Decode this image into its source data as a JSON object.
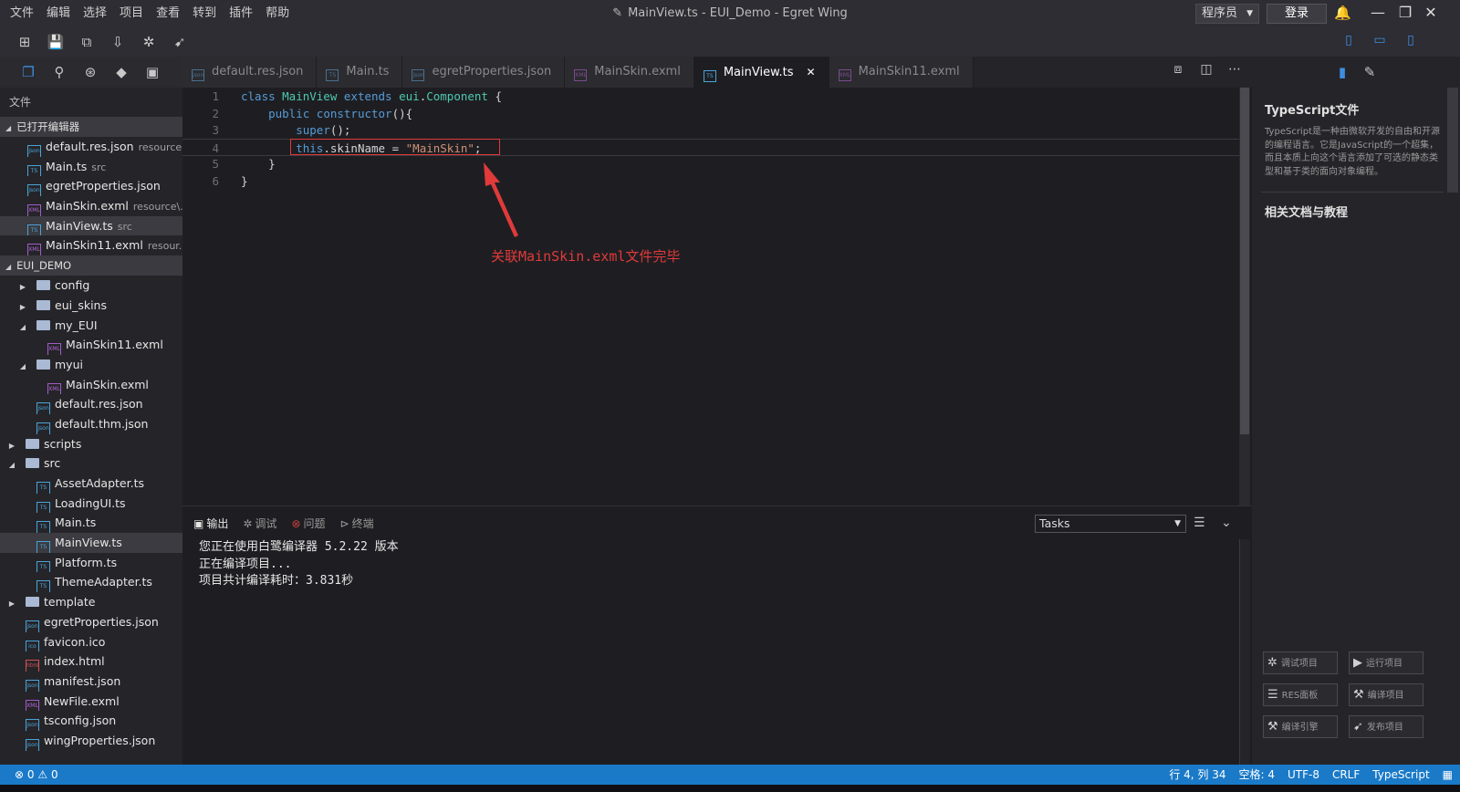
{
  "menu": [
    "文件",
    "编辑",
    "选择",
    "项目",
    "查看",
    "转到",
    "插件",
    "帮助"
  ],
  "window_title": "MainView.ts - EUI_Demo - Egret Wing",
  "role_select": "程序员",
  "login_label": "登录",
  "sidebar": {
    "files_title": "文件",
    "open_editors_header": "已打开编辑器",
    "open_editors": [
      {
        "name": "default.res.json",
        "hint": "resource",
        "icon": "json"
      },
      {
        "name": "Main.ts",
        "hint": "src",
        "icon": "ts"
      },
      {
        "name": "egretProperties.json",
        "hint": "",
        "icon": "json"
      },
      {
        "name": "MainSkin.exml",
        "hint": "resource\\...",
        "icon": "exml"
      },
      {
        "name": "MainView.ts",
        "hint": "src",
        "icon": "ts",
        "selected": true
      },
      {
        "name": "MainSkin11.exml",
        "hint": "resour...",
        "icon": "exml"
      }
    ],
    "project_header": "EUI_DEMO",
    "tree": [
      {
        "name": "config",
        "type": "folder",
        "depth": 2,
        "arrow": "▶"
      },
      {
        "name": "eui_skins",
        "type": "folder",
        "depth": 2,
        "arrow": "▶"
      },
      {
        "name": "my_EUI",
        "type": "folder",
        "depth": 2,
        "arrow": "◢"
      },
      {
        "name": "MainSkin11.exml",
        "type": "exml",
        "depth": 3,
        "arrow": ""
      },
      {
        "name": "myui",
        "type": "folder",
        "depth": 2,
        "arrow": "◢"
      },
      {
        "name": "MainSkin.exml",
        "type": "exml",
        "depth": 3,
        "arrow": ""
      },
      {
        "name": "default.res.json",
        "type": "json",
        "depth": 2,
        "arrow": ""
      },
      {
        "name": "default.thm.json",
        "type": "json",
        "depth": 2,
        "arrow": ""
      },
      {
        "name": "scripts",
        "type": "folder",
        "depth": 1,
        "arrow": "▶"
      },
      {
        "name": "src",
        "type": "folder",
        "depth": 1,
        "arrow": "◢"
      },
      {
        "name": "AssetAdapter.ts",
        "type": "ts",
        "depth": 2,
        "arrow": ""
      },
      {
        "name": "LoadingUI.ts",
        "type": "ts",
        "depth": 2,
        "arrow": ""
      },
      {
        "name": "Main.ts",
        "type": "ts",
        "depth": 2,
        "arrow": ""
      },
      {
        "name": "MainView.ts",
        "type": "ts",
        "depth": 2,
        "arrow": "",
        "selected": true
      },
      {
        "name": "Platform.ts",
        "type": "ts",
        "depth": 2,
        "arrow": ""
      },
      {
        "name": "ThemeAdapter.ts",
        "type": "ts",
        "depth": 2,
        "arrow": ""
      },
      {
        "name": "template",
        "type": "folder",
        "depth": 1,
        "arrow": "▶"
      },
      {
        "name": "egretProperties.json",
        "type": "json",
        "depth": 1,
        "arrow": ""
      },
      {
        "name": "favicon.ico",
        "type": "ico",
        "depth": 1,
        "arrow": ""
      },
      {
        "name": "index.html",
        "type": "html",
        "depth": 1,
        "arrow": ""
      },
      {
        "name": "manifest.json",
        "type": "json",
        "depth": 1,
        "arrow": ""
      },
      {
        "name": "NewFile.exml",
        "type": "exml",
        "depth": 1,
        "arrow": ""
      },
      {
        "name": "tsconfig.json",
        "type": "json",
        "depth": 1,
        "arrow": ""
      },
      {
        "name": "wingProperties.json",
        "type": "json",
        "depth": 1,
        "arrow": ""
      }
    ]
  },
  "tabs": [
    {
      "label": "default.res.json",
      "icon": "json"
    },
    {
      "label": "Main.ts",
      "icon": "ts"
    },
    {
      "label": "egretProperties.json",
      "icon": "json"
    },
    {
      "label": "MainSkin.exml",
      "icon": "exml"
    },
    {
      "label": "MainView.ts",
      "icon": "ts",
      "active": true
    },
    {
      "label": "MainSkin11.exml",
      "icon": "exml"
    }
  ],
  "code_lines": [
    {
      "n": "1",
      "tokens": [
        [
          "kw",
          "class "
        ],
        [
          "cls",
          "MainView "
        ],
        [
          "kw",
          "extends "
        ],
        [
          "cls",
          "eui"
        ],
        [
          "plain",
          "."
        ],
        [
          "cls",
          "Component"
        ],
        [
          "plain",
          " {"
        ]
      ]
    },
    {
      "n": "2",
      "tokens": [
        [
          "plain",
          "    "
        ],
        [
          "kw",
          "public "
        ],
        [
          "kw",
          "constructor"
        ],
        [
          "plain",
          "(){"
        ]
      ]
    },
    {
      "n": "3",
      "tokens": [
        [
          "plain",
          "        "
        ],
        [
          "kw",
          "super"
        ],
        [
          "plain",
          "();"
        ]
      ]
    },
    {
      "n": "4",
      "tokens": [
        [
          "plain",
          "        "
        ],
        [
          "kw",
          "this"
        ],
        [
          "plain",
          ".skinName = "
        ],
        [
          "str",
          "\"MainSkin\""
        ],
        [
          "plain",
          ";"
        ]
      ]
    },
    {
      "n": "5",
      "tokens": [
        [
          "plain",
          "    }"
        ]
      ]
    },
    {
      "n": "6",
      "tokens": [
        [
          "plain",
          "}"
        ]
      ]
    }
  ],
  "annotation": "关联MainSkin.exml文件完毕",
  "panel": {
    "tabs": [
      "输出",
      "调试",
      "问题",
      "终端"
    ],
    "tasks_select": "Tasks",
    "output_lines": [
      "您正在使用白鹭编译器 5.2.22 版本",
      "正在编译项目...",
      "项目共计编译耗时：3.831秒"
    ]
  },
  "right_panel": {
    "title": "TypeScript文件",
    "description": "TypeScript是一种由微软开发的自由和开源的编程语言。它是JavaScript的一个超集，而且本质上向这个语言添加了可选的静态类型和基于类的面向对象编程。",
    "docs_title": "相关文档与教程",
    "buttons": [
      "调试项目",
      "运行项目",
      "RES面板",
      "编译项目",
      "编译引擎",
      "发布项目"
    ]
  },
  "status": {
    "errors": "0",
    "warnings": "0",
    "position": "行 4, 列 34",
    "indent": "空格: 4",
    "encoding": "UTF-8",
    "eol": "CRLF",
    "language": "TypeScript"
  },
  "colors": {
    "accent": "#3d8ee0",
    "statusbar": "#1a7ac8",
    "annotation": "#e03a3a"
  }
}
